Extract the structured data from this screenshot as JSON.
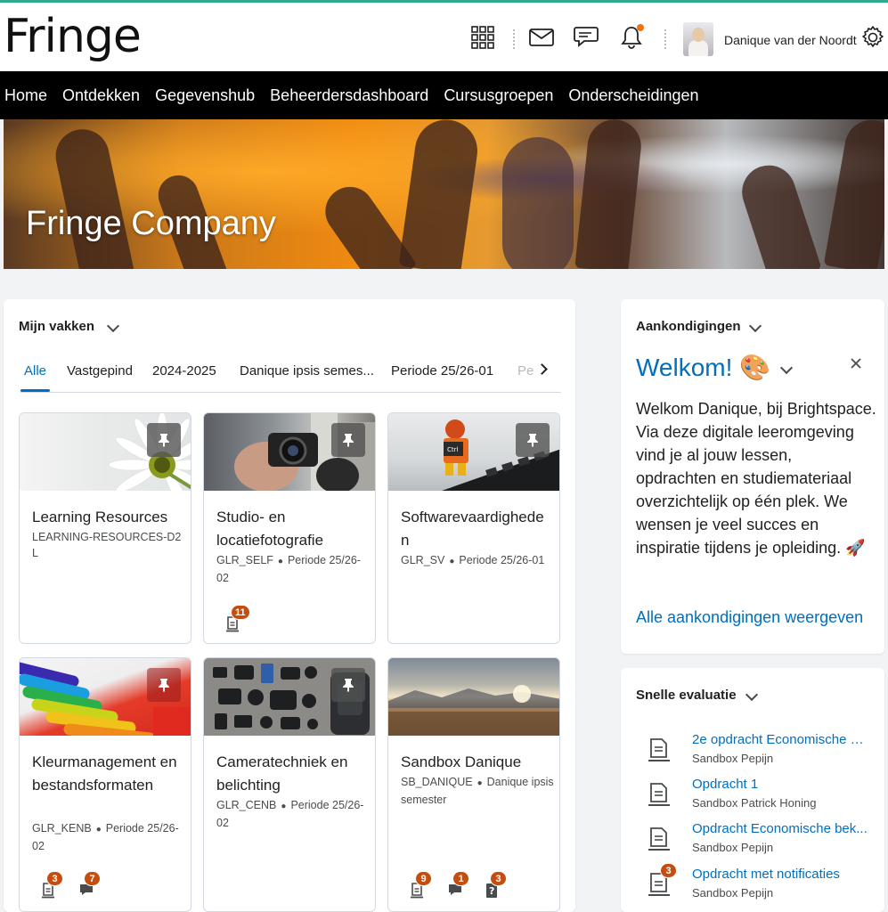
{
  "header": {
    "logo": "Fringe",
    "user_name": "Danique van der Noordt",
    "icons": [
      "apps-grid-icon",
      "mail-icon",
      "chat-icon",
      "bell-icon",
      "gear-icon"
    ]
  },
  "nav": {
    "items": [
      "Home",
      "Ontdekken",
      "Gegevenshub",
      "Beheerdersdashboard",
      "Cursusgroepen",
      "Onderscheidingen"
    ]
  },
  "banner": {
    "title": "Fringe Company"
  },
  "my_courses": {
    "heading": "Mijn vakken",
    "tabs": [
      "Alle",
      "Vastgepind",
      "2024-2025",
      "Danique ipsis semes...",
      "Periode 25/26-01",
      "Pe"
    ],
    "active_tab": "Alle",
    "courses": [
      {
        "title": "Learning Resources",
        "code": "LEARNING-RESOURCES-D2L",
        "period": ""
      },
      {
        "title": "Studio- en locatiefotografie",
        "code": "GLR_SELF",
        "period": "Periode 25/26-02",
        "badges": [
          {
            "icon": "assignment-icon",
            "count": "11"
          }
        ]
      },
      {
        "title": "Softwarevaardigheden",
        "code": "GLR_SV",
        "period": "Periode 25/26-01"
      },
      {
        "title": "Kleurmanagement en bestandsformaten",
        "code": "GLR_KENB",
        "period": "Periode 25/26-02",
        "badges": [
          {
            "icon": "assignment-icon",
            "count": "3"
          },
          {
            "icon": "discussion-icon",
            "count": "7"
          }
        ]
      },
      {
        "title": "Cameratechniek en belichting",
        "code": "GLR_CENB",
        "period": "Periode 25/26-02"
      },
      {
        "title": "Sandbox Danique",
        "code": "SB_DANIQUE",
        "period": "Danique ipsis semester",
        "badges": [
          {
            "icon": "assignment-icon",
            "count": "9"
          },
          {
            "icon": "discussion-icon",
            "count": "1"
          },
          {
            "icon": "quiz-icon",
            "count": "3"
          }
        ]
      }
    ]
  },
  "announcements": {
    "heading": "Aankondigingen",
    "title": "Welkom! 🎨",
    "body": "Welkom Danique, bij Brightspace. Via deze digitale leeromgeving vind je al jouw lessen, opdrachten en studiemateriaal overzichtelijk op één plek. We wensen je veel succes en inspiratie tijdens je opleiding. 🚀",
    "link": "Alle aankondigingen weergeven"
  },
  "quick_eval": {
    "heading": "Snelle evaluatie",
    "items": [
      {
        "title": "2e opdracht Economische be...",
        "course": "Sandbox Pepijn",
        "badge": ""
      },
      {
        "title": "Opdracht 1",
        "course": "Sandbox Patrick Honing",
        "badge": ""
      },
      {
        "title": "Opdracht Economische bek...",
        "course": "Sandbox Pepijn",
        "badge": ""
      },
      {
        "title": "Opdracht met notificaties",
        "course": "Sandbox Pepijn",
        "badge": "3"
      }
    ]
  },
  "colors": {
    "brand": "#2ea98f",
    "link": "#006fbf",
    "badge": "#c44d10",
    "nav_bg": "#000000"
  }
}
